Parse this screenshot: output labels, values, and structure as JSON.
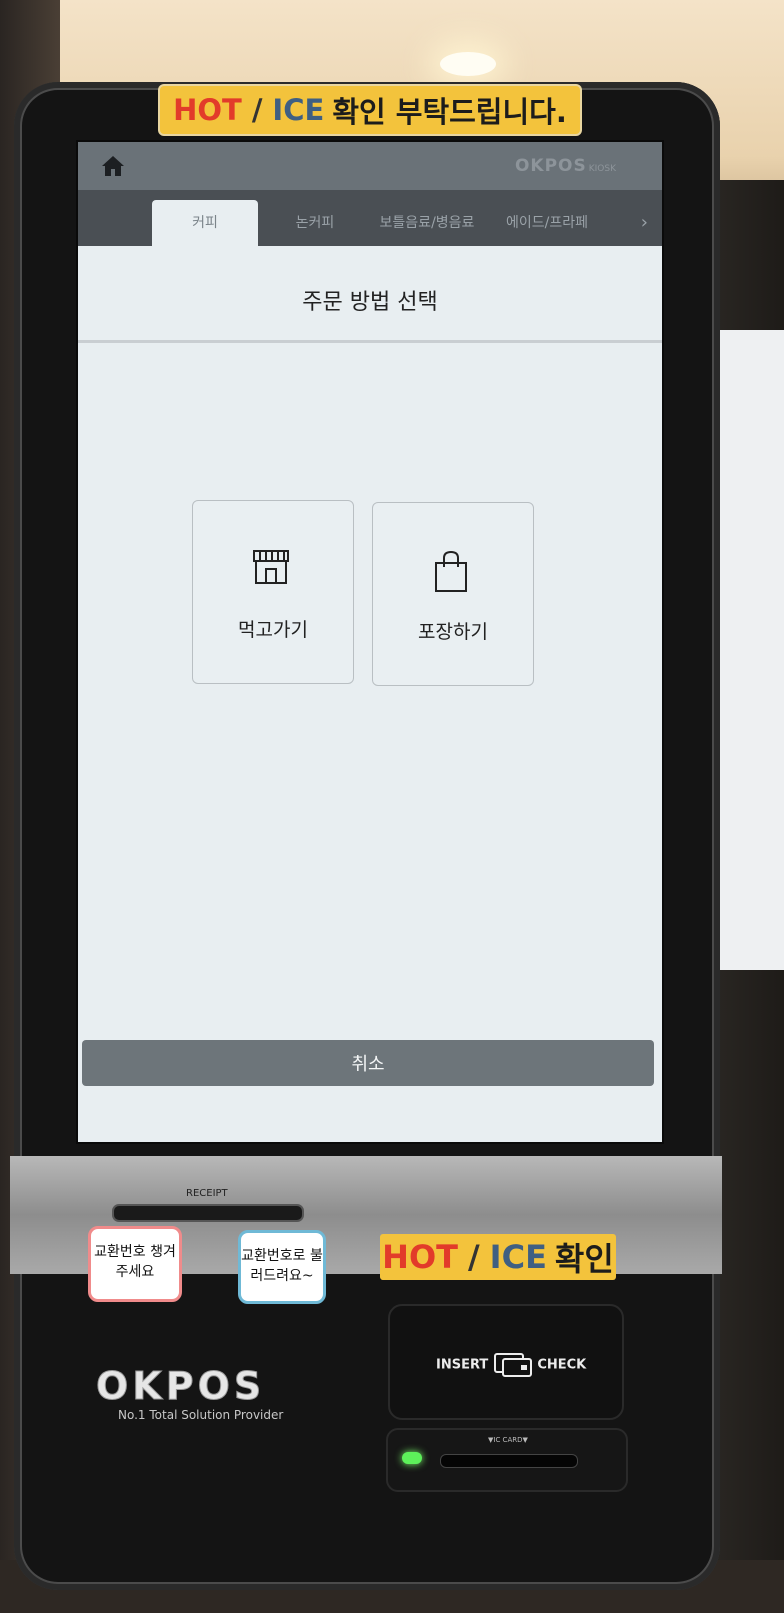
{
  "stickers": {
    "top": {
      "hot": "HOT",
      "slash": "/",
      "ice": "ICE",
      "korean": "확인 부탁드립니다."
    },
    "bottom": {
      "hot": "HOT",
      "slash": "/",
      "ice": "ICE",
      "korean": "확인"
    }
  },
  "header": {
    "brand": "OKPOS",
    "brand_sub": "KIOSK",
    "home_icon": "home-icon"
  },
  "tabs": [
    {
      "label": "커피",
      "active": true
    },
    {
      "label": "논커피",
      "active": false
    },
    {
      "label": "보틀음료/병음료",
      "active": false
    },
    {
      "label": "에이드/프라페",
      "active": false
    }
  ],
  "dialog": {
    "title": "주문 방법 선택",
    "options": [
      {
        "label": "먹고가기",
        "icon": "store-icon"
      },
      {
        "label": "포장하기",
        "icon": "shopping-bag-icon"
      }
    ],
    "cancel_label": "취소"
  },
  "hardware": {
    "receipt_label": "RECEIPT",
    "note_left": "교환번호 챙겨주세요",
    "note_right": "교환번호로 불러드려요~",
    "logo": "OKPOS",
    "logo_tagline": "No.1 Total Solution Provider",
    "card_reader_left": "INSERT",
    "card_reader_right": "CHECK",
    "ic_label": "▼IC CARD▼"
  },
  "colors": {
    "sticker": "#f3c33c",
    "hot": "#e23b2a",
    "ice": "#3f5f82",
    "screen_bg": "#e8eef1",
    "header": "#6a7278",
    "led": "#5df05a"
  }
}
